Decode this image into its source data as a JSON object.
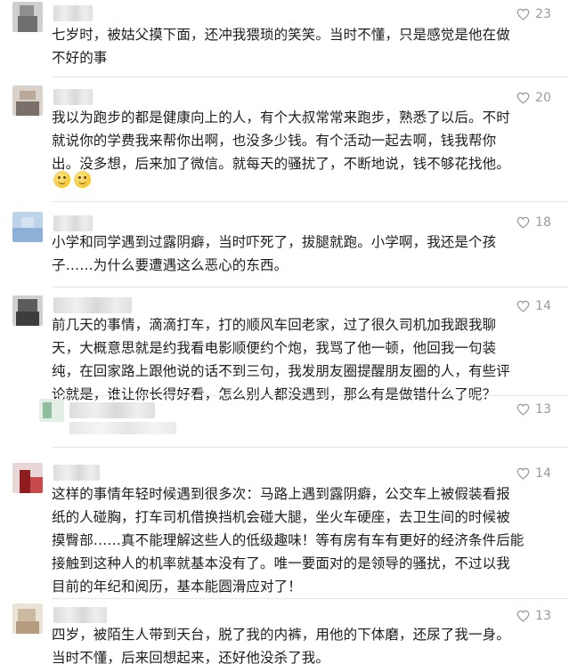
{
  "comments": [
    {
      "likes": "23",
      "text": "七岁时，被姑父摸下面，还冲我猥琐的笑笑。当时不懂，只是感觉是他在做\n不好的事"
    },
    {
      "likes": "20",
      "text": "我以为跑步的都是健康向上的人，有个大叔常常来跑步，熟悉了以后。不时\n就说你的学费我来帮你出啊，也没多少钱。有个活动一起去啊，钱我帮你\n出。没多想，后来加了微信。就每天的骚扰了，不断地说，钱不够花找他。",
      "emojis": [
        "smile-emoji",
        "smile-emoji"
      ]
    },
    {
      "likes": "18",
      "text": "小学和同学遇到过露阴癖，当时吓死了，拔腿就跑。小学啊，我还是个孩\n子……为什么要遭遇这么恶心的东西。"
    },
    {
      "likes": "14",
      "text": "前几天的事情，滴滴打车，打的顺风车回老家，过了很久司机加我跟我聊\n天，大概意思就是约我看电影顺便约个炮，我骂了他一顿，他回我一句装\n纯，在回家路上跟他说的话不到三句，我发朋友圈提醒朋友圈的人，有些评\n论就是，谁让你长得好看，怎么别人都没遇到，那么有是做错什么了呢？"
    },
    {
      "likes": "13",
      "text": ""
    },
    {
      "likes": "14",
      "text": "这样的事情年轻时候遇到很多次：马路上遇到露阴癖，公交车上被假装看报\n纸的人碰胸，打车司机借换挡机会碰大腿，坐火车硬座，去卫生间的时候被\n摸臀部……真不能理解这些人的低级趣味！等有房有车有更好的经济条件后能\n接触到这种人的机率就基本没有了。唯一要面对的是领导的骚扰，不过以我\n目前的年纪和阅历，基本能圆滑应对了！"
    },
    {
      "likes": "13",
      "text": "四岁，被陌生人带到天台，脱了我的内裤，用他的下体磨，还尿了我一身。\n当时不懂，后来回想起来，还好他没杀了我。"
    }
  ],
  "icons": {
    "like": "heart-outline-icon"
  },
  "colors": {
    "like": "#9a9a9a",
    "text": "#1c1c1c",
    "divider": "#e6e6e6"
  }
}
